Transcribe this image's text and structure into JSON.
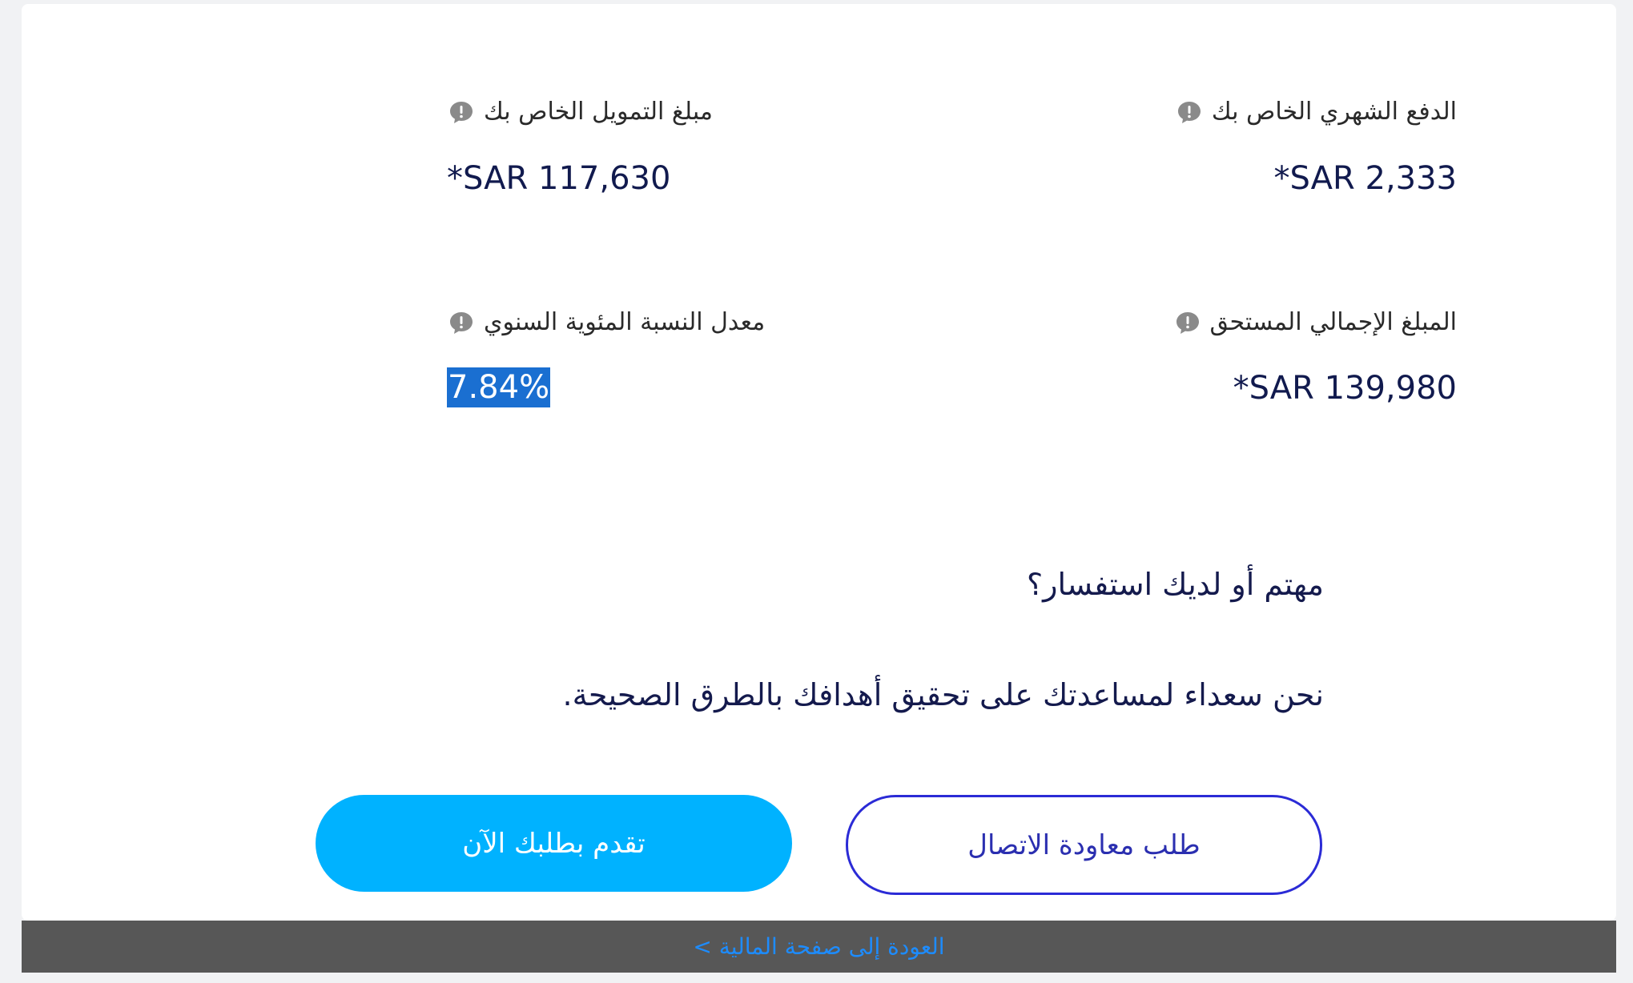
{
  "summary": {
    "monthly_payment": {
      "label": "الدفع الشهري الخاص بك",
      "value": "*SAR 2,333"
    },
    "finance_amount": {
      "label": "مبلغ التمويل الخاص بك",
      "value": "*SAR 117,630"
    },
    "total_amount": {
      "label": "المبلغ الإجمالي المستحق",
      "value": "*SAR 139,980"
    },
    "apr": {
      "label": "معدل النسبة المئوية السنوي",
      "value": "7.84%"
    }
  },
  "cta": {
    "heading": "مهتم أو لديك استفسار؟",
    "subheading": "نحن سعداء لمساعدتك على تحقيق أهدافك بالطرق الصحيحة.",
    "apply_button": "تقدم بطلبك الآن",
    "callback_button": "طلب معاودة الاتصال"
  },
  "footer": {
    "back_link": "العودة إلى صفحة المالية >"
  },
  "colors": {
    "primary_button": "#00b2ff",
    "outline_button": "#2b2bd6",
    "value_text": "#111a4e",
    "footer_bg": "#575757",
    "footer_link": "#1d8cff",
    "selection": "#1a6fd1"
  },
  "icons": {
    "info": "info-icon"
  }
}
